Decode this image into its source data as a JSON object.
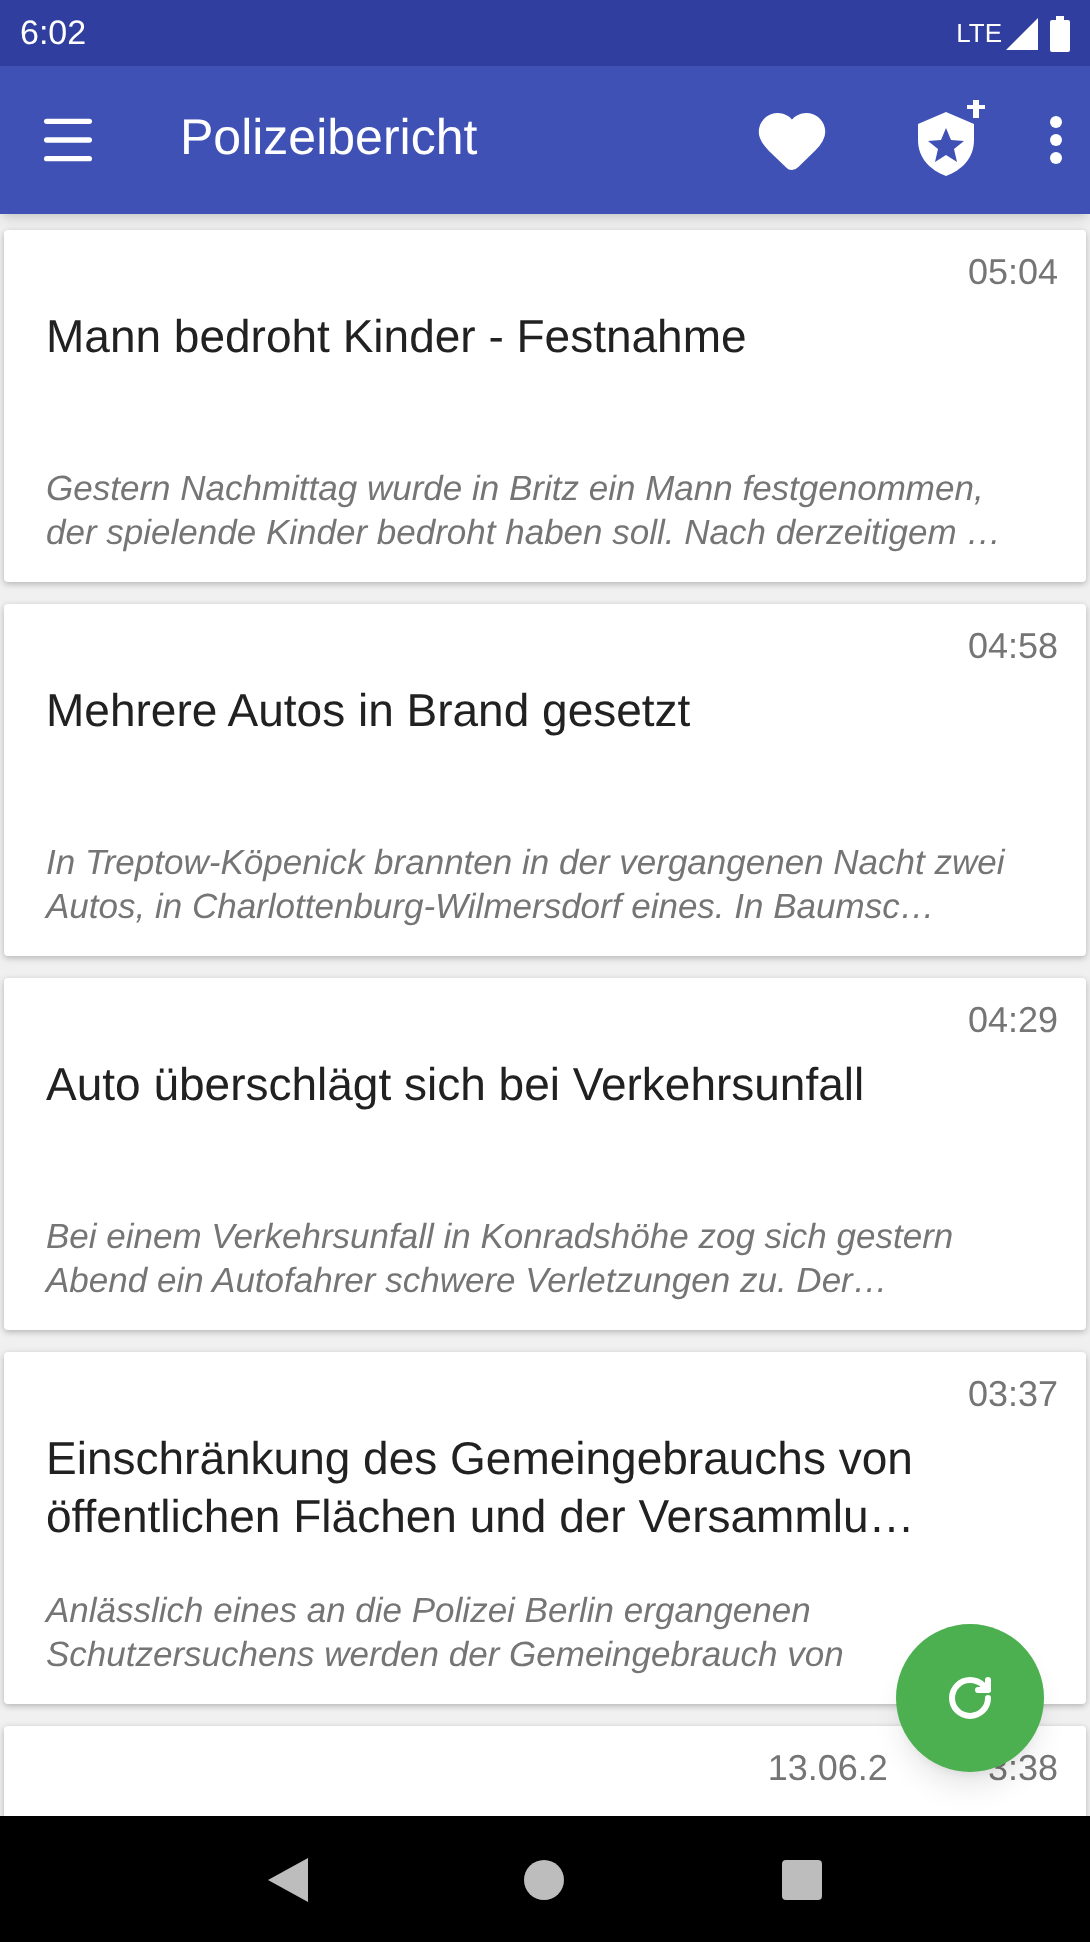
{
  "status_bar": {
    "time": "6:02",
    "network": "LTE"
  },
  "app_bar": {
    "title": "Polizeibericht"
  },
  "reports": [
    {
      "time": "05:04",
      "title": "Mann bedroht Kinder - Festnahme",
      "summary": "Gestern Nachmittag wurde in Britz ein Mann festgenommen, der spielende Kinder bedroht haben soll. Nach derzeitigem …"
    },
    {
      "time": "04:58",
      "title": "Mehrere Autos in Brand gesetzt",
      "summary": "In Treptow-Köpenick brannten in der vergangenen Nacht zwei Autos, in Charlottenburg-Wilmersdorf eines. In Baumsc…"
    },
    {
      "time": "04:29",
      "title": "Auto überschlägt sich bei Verkehrsunfall",
      "summary": "Bei einem Verkehrsunfall in Konradshöhe zog sich gestern Abend ein Autofahrer schwere Verletzungen zu. Der…"
    },
    {
      "time": "03:37",
      "title": "Einschränkung des Gemeingebrauchs von öffentlichen Flächen und der Versammlu…",
      "summary": "Anlässlich eines an die Polizei Berlin ergangenen Schutzersuchens werden der Gemeingebrauch von"
    },
    {
      "time_parts": [
        "13.06.2",
        "3:38"
      ]
    }
  ]
}
